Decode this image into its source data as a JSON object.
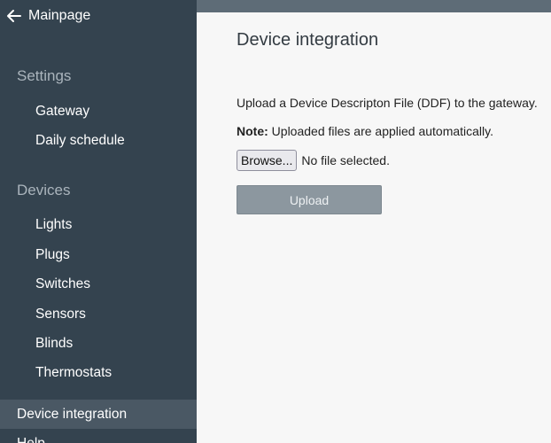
{
  "sidebar": {
    "back_label": "Mainpage",
    "back_icon": "arrow-left-icon",
    "sections": {
      "settings": {
        "title": "Settings",
        "items": [
          "Gateway",
          "Daily schedule"
        ]
      },
      "devices": {
        "title": "Devices",
        "items": [
          "Lights",
          "Plugs",
          "Switches",
          "Sensors",
          "Blinds",
          "Thermostats"
        ]
      }
    },
    "active_item": "Device integration",
    "partial_item": "Help"
  },
  "main": {
    "title": "Device integration",
    "description": "Upload a Device Descripton File (DDF) to the gateway.",
    "note_label": "Note:",
    "note_text": " Uploaded files are applied automatically.",
    "browse_label": "Browse...",
    "file_status": "No file selected.",
    "upload_label": "Upload"
  },
  "colors": {
    "sidebar_bg": "#34434f",
    "active_item_bg": "#4a5864",
    "topbar": "#5e6c77",
    "content_bg": "#f7f7f7",
    "upload_button_bg": "#8c979f"
  }
}
